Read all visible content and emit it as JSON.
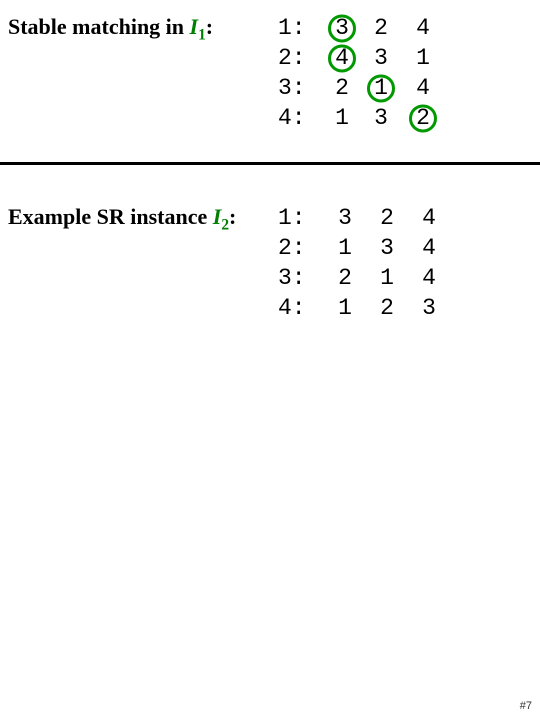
{
  "block1": {
    "label_prefix": "Stable matching in ",
    "var_letter": "I",
    "var_sub": "1",
    "label_suffix": ":",
    "rows": [
      {
        "id": "1:",
        "prefs": [
          "3",
          "2",
          "4"
        ],
        "circled": [
          true,
          false,
          false
        ]
      },
      {
        "id": "2:",
        "prefs": [
          "4",
          "3",
          "1"
        ],
        "circled": [
          true,
          false,
          false
        ]
      },
      {
        "id": "3:",
        "prefs": [
          "2",
          "1",
          "4"
        ],
        "circled": [
          false,
          true,
          false
        ]
      },
      {
        "id": "4:",
        "prefs": [
          "1",
          "3",
          "2"
        ],
        "circled": [
          false,
          false,
          true
        ]
      }
    ]
  },
  "block2": {
    "label_prefix": "Example SR instance ",
    "var_letter": "I",
    "var_sub": "2",
    "label_suffix": ":",
    "rows": [
      {
        "id": "1:",
        "prefs": [
          "3",
          "2",
          "4"
        ],
        "circled": [
          false,
          false,
          false
        ]
      },
      {
        "id": "2:",
        "prefs": [
          "1",
          "3",
          "4"
        ],
        "circled": [
          false,
          false,
          false
        ]
      },
      {
        "id": "3:",
        "prefs": [
          "2",
          "1",
          "4"
        ],
        "circled": [
          false,
          false,
          false
        ]
      },
      {
        "id": "4:",
        "prefs": [
          "1",
          "2",
          "3"
        ],
        "circled": [
          false,
          false,
          false
        ]
      }
    ]
  },
  "page_number": "#7",
  "colors": {
    "accent": "#008000"
  }
}
